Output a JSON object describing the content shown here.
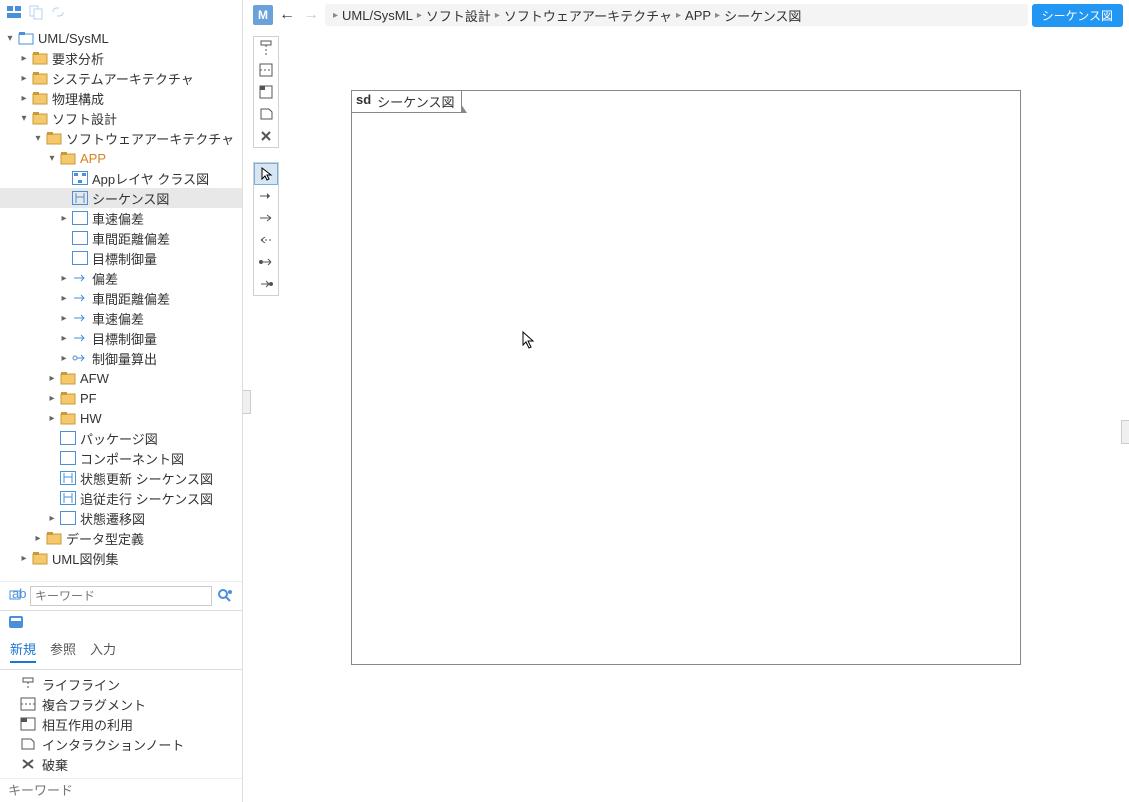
{
  "tree": {
    "root": "UML/SysML",
    "l1": [
      "要求分析",
      "システムアーキテクチャ",
      "物理構成",
      "ソフト設計"
    ],
    "soft_children1": "ソフトウェアアーキテクチャ",
    "app": "APP",
    "app_children": [
      "Appレイヤ クラス図",
      "シーケンス図",
      "車速偏差",
      "車間距離偏差",
      "目標制御量",
      "偏差",
      "車間距離偏差",
      "車速偏差",
      "目標制御量",
      "制御量算出"
    ],
    "arch_rest": [
      "AFW",
      "PF",
      "HW",
      "パッケージ図",
      "コンポーネント図",
      "状態更新 シーケンス図",
      "追従走行 シーケンス図",
      "状態遷移図"
    ],
    "soft_rest": "データ型定義",
    "root_rest": "UML図例集"
  },
  "search": {
    "placeholder": "キーワード"
  },
  "tabs": {
    "new": "新規",
    "ref": "参照",
    "input": "入力"
  },
  "palette": [
    "ライフライン",
    "複合フラグメント",
    "相互作用の利用",
    "インタラクションノート",
    "破棄"
  ],
  "kw_placeholder": "キーワード",
  "header": {
    "m": "M",
    "crumbs": [
      "UML/SysML",
      "ソフト設計",
      "ソフトウェアアーキテクチャ",
      "APP",
      "シーケンス図"
    ],
    "badge": "シーケンス図"
  },
  "canvas": {
    "sd": "sd",
    "title": "シーケンス図"
  }
}
